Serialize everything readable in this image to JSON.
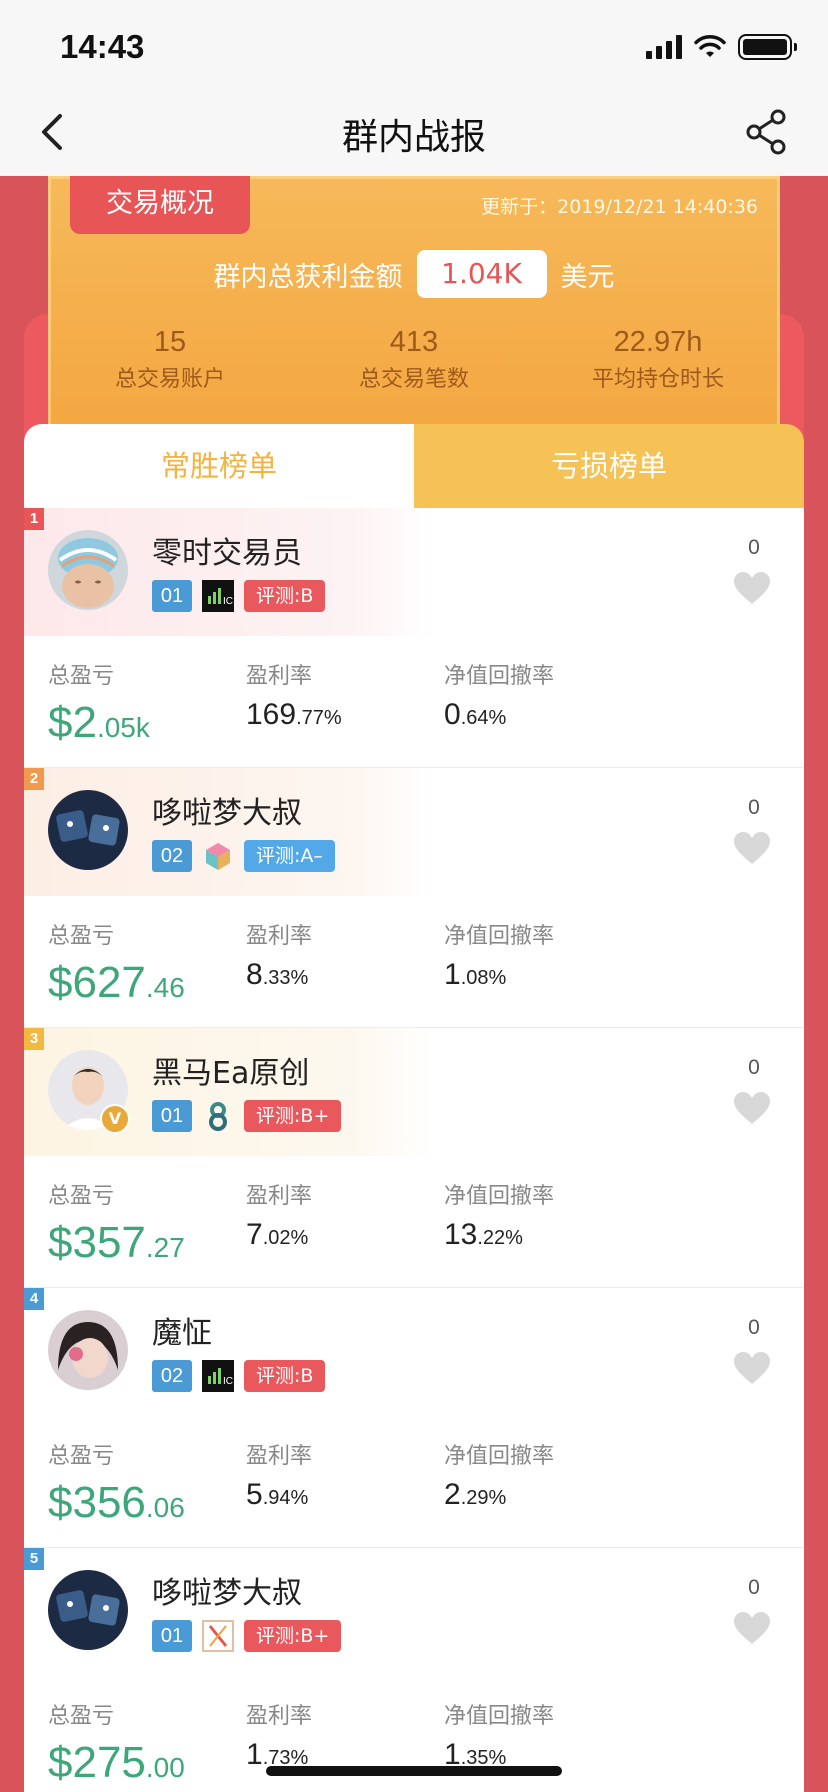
{
  "status": {
    "time": "14:43"
  },
  "nav": {
    "title": "群内战报",
    "back_icon": "chevron-left-icon",
    "share_icon": "share-icon"
  },
  "overview": {
    "tab_label": "交易概况",
    "updated": "更新于：2019/12/21 14:40:36",
    "profit_label": "群内总获利金额",
    "profit_value": "1.04K",
    "profit_unit": "美元",
    "stats": [
      {
        "value": "15",
        "label": "总交易账户"
      },
      {
        "value": "413",
        "label": "总交易笔数"
      },
      {
        "value": "22.97h",
        "label": "平均持仓时长"
      }
    ]
  },
  "tabs": [
    {
      "label": "常胜榜单"
    },
    {
      "label": "亏损榜单"
    }
  ],
  "metric_labels": {
    "profit": "总盈亏",
    "rate": "盈利率",
    "drawdown": "净值回撤率"
  },
  "colors": {
    "rank1": "#e75557",
    "rank2": "#f09a50",
    "rank3": "#f2b840",
    "rank4": "#4a9ad6",
    "rank5": "#4a9ad6",
    "grade_red": "#e9585c",
    "grade_blue": "#53a9e8",
    "money": "#3ea77a"
  },
  "items": [
    {
      "rank": "1",
      "name": "零时交易员",
      "num": "01",
      "grade": "评测:B",
      "grade_color": "red",
      "likes": "0",
      "profit_int": "$2",
      "profit_dec": ".05k",
      "rate_int": "169",
      "rate_dec": ".77%",
      "dd_int": "0",
      "dd_dec": ".64%"
    },
    {
      "rank": "2",
      "name": "哆啦梦大叔",
      "num": "02",
      "grade": "评测:A–",
      "grade_color": "blue",
      "likes": "0",
      "profit_int": "$627",
      "profit_dec": ".46",
      "rate_int": "8",
      "rate_dec": ".33%",
      "dd_int": "1",
      "dd_dec": ".08%"
    },
    {
      "rank": "3",
      "name": "黑马Ea原创",
      "num": "01",
      "grade": "评测:B+",
      "grade_color": "red",
      "likes": "0",
      "profit_int": "$357",
      "profit_dec": ".27",
      "rate_int": "7",
      "rate_dec": ".02%",
      "dd_int": "13",
      "dd_dec": ".22%"
    },
    {
      "rank": "4",
      "name": "魔怔",
      "num": "02",
      "grade": "评测:B",
      "grade_color": "red",
      "likes": "0",
      "profit_int": "$356",
      "profit_dec": ".06",
      "rate_int": "5",
      "rate_dec": ".94%",
      "dd_int": "2",
      "dd_dec": ".29%"
    },
    {
      "rank": "5",
      "name": "哆啦梦大叔",
      "num": "01",
      "grade": "评测:B+",
      "grade_color": "red",
      "likes": "0",
      "profit_int": "$275",
      "profit_dec": ".00",
      "rate_int": "1",
      "rate_dec": ".73%",
      "dd_int": "1",
      "dd_dec": ".35%"
    }
  ]
}
